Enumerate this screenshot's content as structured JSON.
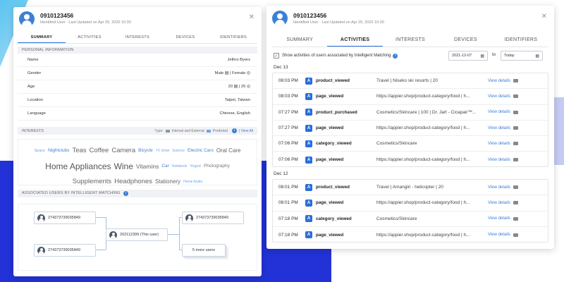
{
  "colors": {
    "accent": "#2a6fdb",
    "avatar": "#3c7fd6",
    "background_block": "#2232d6",
    "internal_external": "#8e96a3",
    "predicted": "#6fa3e6"
  },
  "left_panel": {
    "user_id": "0910123456",
    "identified": "Identified User",
    "last_updated": "Last Updated on Apr 25, 2020 10:30",
    "tabs": [
      "SUMMARY",
      "ACTIVITIES",
      "INTERESTS",
      "DEVICES",
      "IDENTIFIERS"
    ],
    "active_tab": "SUMMARY",
    "personal_info_label": "PERSONAL INFORMATION",
    "personal_info": [
      {
        "key": "Name",
        "value": "Jethro Byers"
      },
      {
        "key": "Gender",
        "value": "Male ▤ | Female ◎"
      },
      {
        "key": "Age",
        "value": "20 ▤ | 25 ◎"
      },
      {
        "key": "Location",
        "value": "Taipei, Taiwan"
      },
      {
        "key": "Language",
        "value": "Chinese, English"
      }
    ],
    "interests_label": "INTERESTS",
    "legend": {
      "type_label": "Type:",
      "internal": "Internal and External",
      "predicted": "Predicted",
      "view_all": "| View All"
    },
    "interest_words": [
      {
        "text": "Space",
        "size": 5.5,
        "color": "#6fa3e6"
      },
      {
        "text": "Nightclubs",
        "size": 6.5,
        "color": "#3c7fd6"
      },
      {
        "text": "Teas",
        "size": 9.5,
        "color": "#666"
      },
      {
        "text": "Coffee",
        "size": 9.5,
        "color": "#666"
      },
      {
        "text": "Camera",
        "size": 9.5,
        "color": "#666"
      },
      {
        "text": "Bicycle",
        "size": 6.5,
        "color": "#3c7fd6"
      },
      {
        "text": "TV show",
        "size": 5,
        "color": "#6fa3e6"
      },
      {
        "text": "Science",
        "size": 5,
        "color": "#6fa3e6"
      },
      {
        "text": "Electric Cars",
        "size": 6.5,
        "color": "#3c7fd6"
      },
      {
        "text": "Oral Care",
        "size": 8,
        "color": "#666"
      },
      {
        "text": "Home Appliances",
        "size": 12,
        "color": "#555"
      },
      {
        "text": "Wine",
        "size": 12,
        "color": "#555"
      },
      {
        "text": "Vitamins",
        "size": 8.5,
        "color": "#666"
      },
      {
        "text": "Car",
        "size": 6.5,
        "color": "#3c7fd6"
      },
      {
        "text": "Notebook",
        "size": 5,
        "color": "#6fa3e6"
      },
      {
        "text": "Yogurt",
        "size": 5.5,
        "color": "#6fa3e6"
      },
      {
        "text": "Photography",
        "size": 6.5,
        "color": "#777"
      },
      {
        "text": "Supplements",
        "size": 9.5,
        "color": "#666"
      },
      {
        "text": "Headphones",
        "size": 9.5,
        "color": "#666"
      },
      {
        "text": "Stationery",
        "size": 8,
        "color": "#666"
      },
      {
        "text": "Home Audio",
        "size": 5,
        "color": "#6fa3e6"
      }
    ],
    "assoc_label": "ASSOCIATED USERS BY INTELLIGENT MATCHING",
    "assoc_nodes": {
      "top_left": "274373739035849",
      "bottom_left": "274373739035849",
      "center": "202112399 (This user)",
      "top_right": "274373739035849",
      "more": "5 more users"
    }
  },
  "right_panel": {
    "user_id": "0910123456",
    "identified": "Identified User",
    "last_updated": "Last Updated on Apr 25, 2020 10:30",
    "tabs": [
      "SUMMARY",
      "ACTIVITIES",
      "INTERESTS",
      "DEVICES",
      "IDENTIFIERS"
    ],
    "active_tab": "ACTIVITIES",
    "filter": {
      "checkbox_label": "Show activities of users associated by Intelligent Matching",
      "checked": true,
      "from": "2021-12-07",
      "to_label": "to",
      "to": "Today"
    },
    "groups": [
      {
        "day": "Dec 13",
        "rows": [
          {
            "time": "08:03 PM",
            "event": "product_viewed",
            "detail": "Travel | Niseko ski resorts | 20",
            "link": "View details"
          },
          {
            "time": "08:03 PM",
            "event": "page_viewed",
            "detail": "https://appier.shop/product-category/food | h...",
            "link": "View details"
          },
          {
            "time": "07:27 PM",
            "event": "product_purchased",
            "detail": "Cosmetics/Skincare | 100 | Dr. Jart - Cicapair™...",
            "link": "View details"
          },
          {
            "time": "07:27 PM",
            "event": "page_viewed",
            "detail": "https://appier.shop/product-category/food | h...",
            "link": "View details"
          },
          {
            "time": "07:06 PM",
            "event": "category_viewed",
            "detail": "Cosmetics/Skincare",
            "link": "View details"
          },
          {
            "time": "07:06 PM",
            "event": "page_viewed",
            "detail": "https://appier.shop/product-category/food | h...",
            "link": "View details"
          }
        ]
      },
      {
        "day": "Dec 12",
        "rows": [
          {
            "time": "08:01 PM",
            "event": "product_viewed",
            "detail": "Travel | Amangiri - helicopter | 20",
            "link": "View details"
          },
          {
            "time": "08:01 PM",
            "event": "page_viewed",
            "detail": "https://appier.shop/product-category/food | h...",
            "link": "View details"
          },
          {
            "time": "07:18 PM",
            "event": "category_viewed",
            "detail": "Cosmetics/Skincare",
            "link": "View details"
          },
          {
            "time": "07:18 PM",
            "event": "page_viewed",
            "detail": "https://appier.shop/product-category/food | h...",
            "link": "View details"
          }
        ]
      }
    ]
  }
}
